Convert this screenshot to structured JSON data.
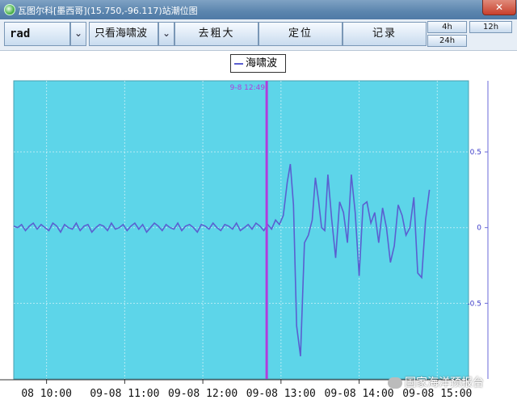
{
  "window": {
    "title": "瓦图尔科[墨西哥](15.750,-96.117)站潮位图",
    "close_glyph": "✕"
  },
  "toolbar": {
    "unit_select": "rad",
    "filter_select": "只看海啸波",
    "dropdown_glyph": "⌄",
    "remove_coarse": "去粗大",
    "locate": "定位",
    "record": "记录",
    "range_4h": "4h",
    "range_12h": "12h",
    "range_24h": "24h"
  },
  "legend": {
    "series_name": "海啸波"
  },
  "watermark": {
    "text": "国家海洋预报台"
  },
  "colors": {
    "plot_bg": "#5dd5e9",
    "series": "#5a5fd0",
    "marker": "#b13ddb",
    "axis_text": "#3a3ac8"
  },
  "chart_data": {
    "type": "line",
    "marker_label": "9-8 12:49",
    "x_tick_labels": [
      "08 10:00",
      "09-08 11:00",
      "09-08 12:00",
      "09-08 13:00",
      "09-08 14:00",
      "09-08 15:00"
    ],
    "x_tick_hours": [
      10,
      11,
      12,
      13,
      14,
      15
    ],
    "marker_hour": 12.817,
    "x_range_hours": [
      9.58,
      15.4
    ],
    "y_tick_labels": [
      "0.5",
      "0",
      "-0.5"
    ],
    "y_ticks": [
      0.5,
      0,
      -0.5
    ],
    "ylim": [
      -1.0,
      0.97
    ],
    "grid": true,
    "series": [
      {
        "name": "海啸波",
        "x_hours": [
          9.58,
          9.63,
          9.68,
          9.73,
          9.78,
          9.83,
          9.88,
          9.93,
          9.98,
          10.03,
          10.08,
          10.13,
          10.18,
          10.23,
          10.28,
          10.33,
          10.38,
          10.43,
          10.48,
          10.53,
          10.58,
          10.63,
          10.68,
          10.73,
          10.78,
          10.83,
          10.88,
          10.93,
          10.98,
          11.03,
          11.08,
          11.13,
          11.18,
          11.23,
          11.28,
          11.33,
          11.38,
          11.43,
          11.48,
          11.53,
          11.58,
          11.63,
          11.68,
          11.73,
          11.78,
          11.83,
          11.88,
          11.93,
          11.98,
          12.03,
          12.08,
          12.13,
          12.18,
          12.23,
          12.28,
          12.33,
          12.38,
          12.43,
          12.48,
          12.53,
          12.58,
          12.63,
          12.68,
          12.73,
          12.78,
          12.83,
          12.88,
          12.93,
          12.98,
          13.03,
          13.08,
          13.12,
          13.16,
          13.2,
          13.25,
          13.3,
          13.35,
          13.4,
          13.44,
          13.48,
          13.52,
          13.56,
          13.6,
          13.65,
          13.7,
          13.75,
          13.8,
          13.85,
          13.9,
          13.95,
          14.0,
          14.05,
          14.1,
          14.15,
          14.2,
          14.25,
          14.3,
          14.35,
          14.4,
          14.45,
          14.5,
          14.55,
          14.6,
          14.65,
          14.7,
          14.75,
          14.8,
          14.85,
          14.9
        ],
        "values": [
          0.01,
          0.0,
          0.02,
          -0.02,
          0.01,
          0.03,
          -0.01,
          0.02,
          0.0,
          -0.02,
          0.03,
          0.01,
          -0.03,
          0.02,
          0.0,
          -0.01,
          0.03,
          -0.02,
          0.01,
          0.02,
          -0.03,
          0.0,
          0.02,
          0.01,
          -0.02,
          0.03,
          -0.01,
          0.0,
          0.02,
          -0.02,
          0.01,
          0.03,
          -0.01,
          0.02,
          -0.03,
          0.0,
          0.03,
          0.01,
          -0.02,
          0.02,
          0.0,
          -0.01,
          0.03,
          -0.02,
          0.01,
          0.02,
          0.0,
          -0.03,
          0.02,
          0.01,
          -0.01,
          0.03,
          0.0,
          -0.02,
          0.02,
          0.01,
          -0.01,
          0.03,
          -0.02,
          0.0,
          0.02,
          -0.01,
          0.03,
          0.01,
          -0.02,
          0.02,
          -0.01,
          0.05,
          0.02,
          0.08,
          0.3,
          0.42,
          0.15,
          -0.65,
          -0.85,
          -0.1,
          -0.05,
          0.05,
          0.33,
          0.18,
          0.0,
          -0.02,
          0.35,
          0.05,
          -0.2,
          0.17,
          0.1,
          -0.1,
          0.35,
          0.1,
          -0.32,
          0.15,
          0.17,
          0.03,
          0.1,
          -0.1,
          0.13,
          0.0,
          -0.23,
          -0.12,
          0.15,
          0.08,
          -0.05,
          0.0,
          0.2,
          -0.3,
          -0.33,
          0.05,
          0.25
        ]
      }
    ]
  }
}
